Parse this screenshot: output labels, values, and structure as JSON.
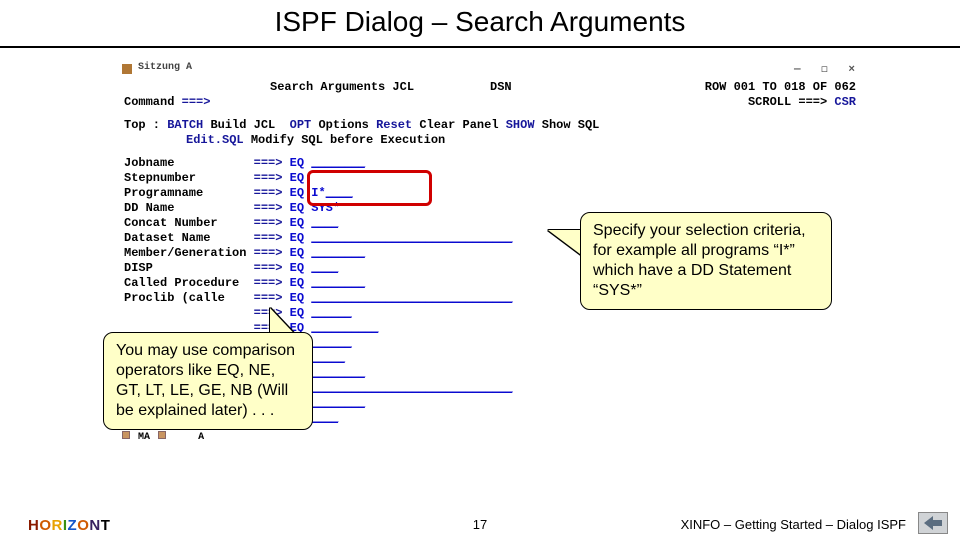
{
  "title": "ISPF Dialog – Search Arguments",
  "term": {
    "app_name": "Sitzung A",
    "panel_title": "Search Arguments JCL",
    "panel_context": "DSN",
    "row_info": "ROW 001 TO 018 OF 062",
    "command_label": "Command",
    "arrows": "===>",
    "scroll_label": "SCROLL ===>",
    "scroll_value": "CSR",
    "menu_line1_a": "Top    :",
    "menu_line1_b": "BATCH",
    "menu_line1_c": "Build JCL",
    "menu_line1_d": "OPT",
    "menu_line1_e": "Options",
    "menu_line1_f": "Reset",
    "menu_line1_g": "Clear Panel",
    "menu_line1_h": "SHOW",
    "menu_line1_i": "Show SQL",
    "menu_line2": "Edit.SQL Modify SQL before Execution",
    "status_a": "MA",
    "status_b": "A",
    "fields": [
      {
        "label": "Jobname",
        "val": "",
        "ulen": 8
      },
      {
        "label": "Stepnumber",
        "val": "",
        "ulen": 0
      },
      {
        "label": "Programname",
        "val": "I*",
        "ulen": 6
      },
      {
        "label": "DD Name",
        "val": "SYS*",
        "ulen": 4
      },
      {
        "label": "Concat Number",
        "val": "",
        "ulen": 4
      },
      {
        "label": "Dataset Name",
        "val": "",
        "ulen": 30
      },
      {
        "label": "Member/Generation",
        "val": "",
        "ulen": 8
      },
      {
        "label": "DISP",
        "val": "",
        "ulen": 4
      },
      {
        "label": "Called Procedure",
        "val": "",
        "ulen": 8
      },
      {
        "label": "Proclib (calle",
        "val": "",
        "ulen": 30
      },
      {
        "label": "",
        "val": "",
        "ulen": 6
      },
      {
        "label": "",
        "val": "",
        "ulen": 10
      },
      {
        "label": "",
        "val": "",
        "ulen": 6
      },
      {
        "label": "",
        "val": "",
        "ulen": 5
      },
      {
        "label": "",
        "val": "",
        "ulen": 8
      },
      {
        "label": "",
        "val": "",
        "ulen": 30
      },
      {
        "label": "",
        "val": "",
        "ulen": 8
      },
      {
        "label": "",
        "val": "",
        "ulen": 4
      }
    ]
  },
  "callouts": {
    "left": "You may use comparison operators like EQ, NE, GT, LT, LE, GE, NB (Will be explained later) . . .",
    "right": "Specify your selection criteria, for example all programs “I*” which have a DD Statement “SYS*”"
  },
  "footer": {
    "brand": "HORIZONT",
    "page_num": "17",
    "doc": "XINFO – Getting Started – Dialog ISPF"
  }
}
